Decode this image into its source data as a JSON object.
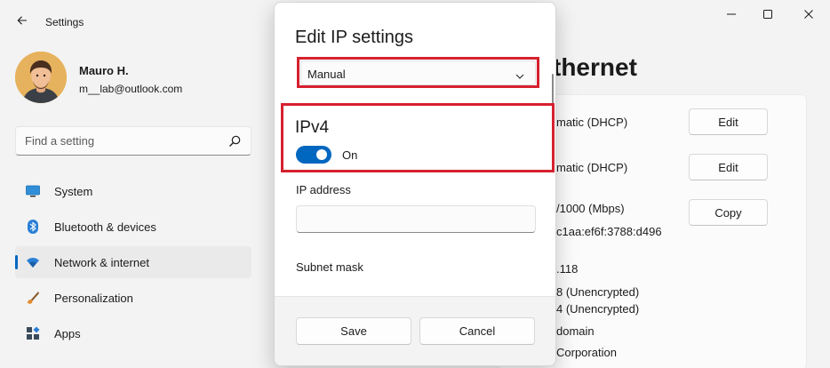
{
  "window": {
    "app_title": "Settings"
  },
  "profile": {
    "name": "Mauro H.",
    "email": "m__lab@outlook.com"
  },
  "search": {
    "placeholder": "Find a setting",
    "value": ""
  },
  "nav": {
    "items": [
      {
        "label": "System",
        "icon": "monitor-icon"
      },
      {
        "label": "Bluetooth & devices",
        "icon": "bluetooth-icon"
      },
      {
        "label": "Network & internet",
        "icon": "wifi-icon",
        "active": true
      },
      {
        "label": "Personalization",
        "icon": "brush-icon"
      },
      {
        "label": "Apps",
        "icon": "apps-icon"
      }
    ]
  },
  "main": {
    "title_fragment": "thernet",
    "property_values": [
      "matic (DHCP)",
      "matic (DHCP)",
      "/1000 (Mbps)",
      "c1aa:ef6f:3788:d496",
      ".118",
      "8 (Unencrypted)",
      "4 (Unencrypted)",
      "domain",
      "Corporation"
    ],
    "buttons": {
      "edit_1": "Edit",
      "edit_2": "Edit",
      "copy": "Copy"
    }
  },
  "dialog": {
    "title": "Edit IP settings",
    "mode_select": {
      "value": "Manual"
    },
    "ipv4": {
      "title": "IPv4",
      "toggle_state": "On"
    },
    "fields": {
      "ip_address_label": "IP address",
      "ip_address_value": "",
      "subnet_mask_label": "Subnet mask"
    },
    "footer": {
      "save_label": "Save",
      "cancel_label": "Cancel"
    }
  },
  "colors": {
    "accent": "#0067c0",
    "highlight": "#d6212f",
    "background": "#f3f3f3"
  }
}
